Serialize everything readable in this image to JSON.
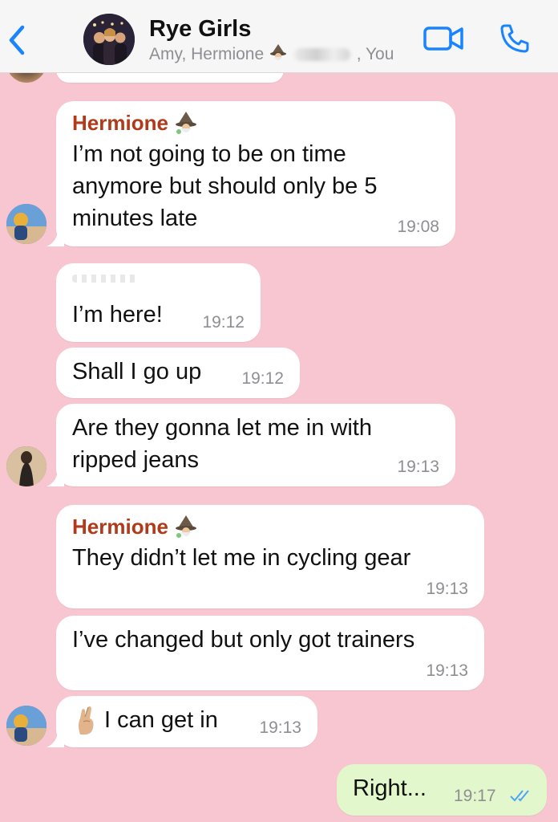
{
  "header": {
    "title": "Rye Girls",
    "members_left": "Amy, Hermione",
    "members_right": ", You"
  },
  "messages": [
    {
      "sender": "Hermione",
      "text_lines": [
        "I’m not going to be on time",
        "anymore but should only be 5",
        "minutes late"
      ],
      "time": "19:08"
    },
    {
      "text": "I’m here!",
      "time": "19:12"
    },
    {
      "text": "Shall I go up",
      "time": "19:12"
    },
    {
      "text_lines": [
        "Are they gonna let me in with",
        "ripped jeans"
      ],
      "time": "19:13"
    },
    {
      "sender": "Hermione",
      "text": "They didn’t let me in cycling gear",
      "time": "19:13"
    },
    {
      "text": "I’ve changed but only got trainers",
      "time": "19:13"
    },
    {
      "text": "I can get in",
      "time": "19:13",
      "emoji": "crossed-fingers"
    },
    {
      "text": "Right...",
      "time": "19:17",
      "outgoing": true,
      "status": "read"
    }
  ],
  "colors": {
    "chat_background": "#f8c6d0",
    "sender_name": "#b03a1a",
    "accent": "#1a84ff",
    "outgoing_bubble": "#e2f7cb",
    "read_ticks": "#4fa3f7"
  }
}
